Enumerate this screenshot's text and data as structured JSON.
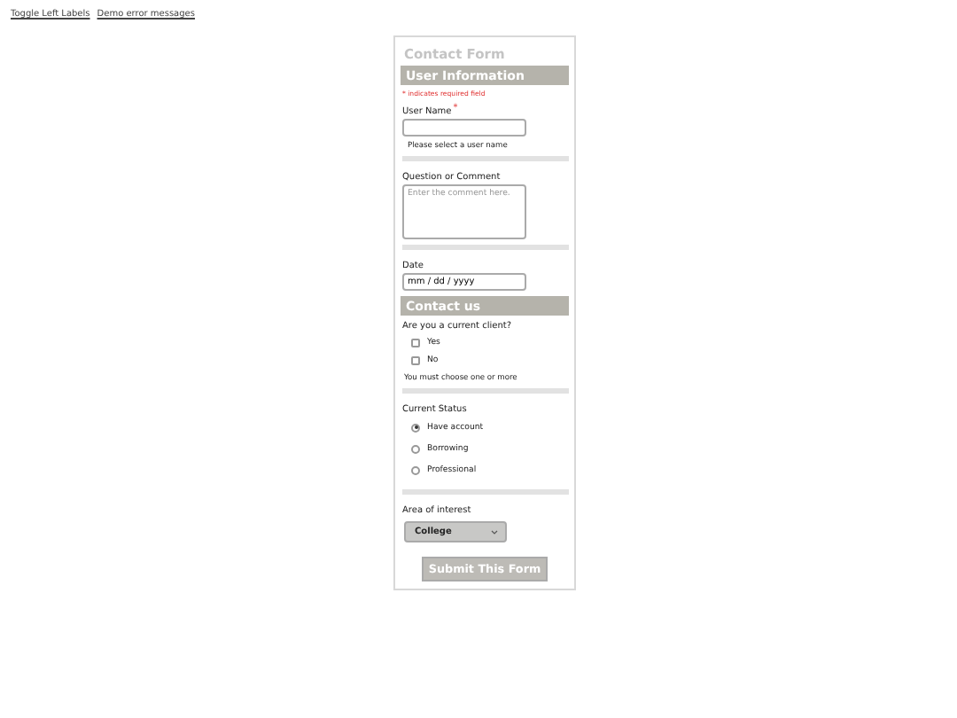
{
  "top_links": [
    "Toggle Left Labels",
    "Demo error messages"
  ],
  "form": {
    "title": "Contact Form",
    "sections": [
      {
        "header": "User Information",
        "required_note": "* indicates required field",
        "fields": [
          {
            "kind": "text",
            "label": "User Name",
            "required_mark": "*",
            "hint": "Please select a user name"
          },
          {
            "kind": "textarea",
            "label": "Question or Comment",
            "placeholder": "Enter the comment here."
          },
          {
            "kind": "date",
            "label": "Date",
            "value": "mm / dd / yyyy"
          }
        ]
      },
      {
        "header": "Contact us",
        "fields": [
          {
            "kind": "checkboxes",
            "label": "Are you a current client?",
            "options": [
              {
                "label": "Yes",
                "checked": false
              },
              {
                "label": "No",
                "checked": false
              }
            ],
            "hint": "You must choose one or more"
          },
          {
            "kind": "radios",
            "label": "Current Status",
            "options": [
              {
                "label": "Have account",
                "selected": true
              },
              {
                "label": "Borrowing",
                "selected": false
              },
              {
                "label": "Professional",
                "selected": false
              }
            ]
          },
          {
            "kind": "select",
            "label": "Area of interest",
            "value": "College"
          }
        ]
      }
    ],
    "submit": "Submit This Form"
  }
}
